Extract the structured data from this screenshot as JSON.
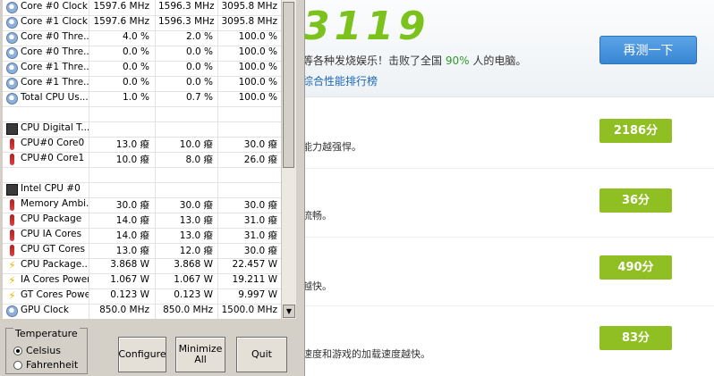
{
  "benchmark": {
    "score": "3119",
    "summary_left": "等各种发烧娱乐！击败了全国",
    "summary_percent": "90%",
    "summary_right": "人的电脑。",
    "rank_link": "综合性能排行榜",
    "retest_button": "再测一下",
    "rows": [
      {
        "desc": "能力越强悍。",
        "score": "2186分"
      },
      {
        "desc": "流畅。",
        "score": "36分"
      },
      {
        "desc": "越快。",
        "score": "490分"
      },
      {
        "desc": "速度和游戏的加载速度越快。",
        "score": "83分"
      }
    ]
  },
  "hwmonitor": {
    "rows": [
      {
        "icon": "clock-icon",
        "name": "Core #0 Clock",
        "v1": "1597.6 MHz",
        "v2": "1596.3 MHz",
        "v3": "3095.8 MHz"
      },
      {
        "icon": "clock-icon",
        "name": "Core #1 Clock",
        "v1": "1597.6 MHz",
        "v2": "1596.3 MHz",
        "v3": "3095.8 MHz"
      },
      {
        "icon": "clock-icon",
        "name": "Core #0 Thre...",
        "v1": "4.0 %",
        "v2": "2.0 %",
        "v3": "100.0 %"
      },
      {
        "icon": "clock-icon",
        "name": "Core #0 Thre...",
        "v1": "0.0 %",
        "v2": "0.0 %",
        "v3": "100.0 %"
      },
      {
        "icon": "clock-icon",
        "name": "Core #1 Thre...",
        "v1": "0.0 %",
        "v2": "0.0 %",
        "v3": "100.0 %"
      },
      {
        "icon": "clock-icon",
        "name": "Core #1 Thre...",
        "v1": "0.0 %",
        "v2": "0.0 %",
        "v3": "100.0 %"
      },
      {
        "icon": "clock-icon",
        "name": "Total CPU Us...",
        "v1": "1.0 %",
        "v2": "0.7 %",
        "v3": "100.0 %"
      },
      {
        "icon": "",
        "name": "",
        "v1": "",
        "v2": "",
        "v3": ""
      },
      {
        "icon": "chip-icon",
        "name": "CPU Digital T...",
        "v1": "",
        "v2": "",
        "v3": ""
      },
      {
        "icon": "thermometer-icon",
        "name": "CPU#0 Core0",
        "v1": "13.0 癈",
        "v2": "10.0 癈",
        "v3": "30.0 癈"
      },
      {
        "icon": "thermometer-icon",
        "name": "CPU#0 Core1",
        "v1": "10.0 癈",
        "v2": "8.0 癈",
        "v3": "26.0 癈"
      },
      {
        "icon": "",
        "name": "",
        "v1": "",
        "v2": "",
        "v3": ""
      },
      {
        "icon": "chip-icon",
        "name": "Intel CPU #0",
        "v1": "",
        "v2": "",
        "v3": ""
      },
      {
        "icon": "thermometer-icon",
        "name": "Memory Ambi...",
        "v1": "30.0 癈",
        "v2": "30.0 癈",
        "v3": "30.0 癈"
      },
      {
        "icon": "thermometer-icon",
        "name": "CPU Package",
        "v1": "14.0 癈",
        "v2": "13.0 癈",
        "v3": "31.0 癈"
      },
      {
        "icon": "thermometer-icon",
        "name": "CPU IA Cores",
        "v1": "14.0 癈",
        "v2": "13.0 癈",
        "v3": "31.0 癈"
      },
      {
        "icon": "thermometer-icon",
        "name": "CPU GT Cores",
        "v1": "13.0 癈",
        "v2": "12.0 癈",
        "v3": "30.0 癈"
      },
      {
        "icon": "lightning-icon",
        "name": "CPU Package...",
        "v1": "3.868 W",
        "v2": "3.868 W",
        "v3": "22.457 W"
      },
      {
        "icon": "lightning-icon",
        "name": "IA Cores Power",
        "v1": "1.067 W",
        "v2": "1.067 W",
        "v3": "19.211 W"
      },
      {
        "icon": "lightning-icon",
        "name": "GT Cores Power",
        "v1": "0.123 W",
        "v2": "0.123 W",
        "v3": "9.997 W"
      },
      {
        "icon": "clock-icon",
        "name": "GPU Clock",
        "v1": "850.0 MHz",
        "v2": "850.0 MHz",
        "v3": "1500.0 MHz"
      }
    ],
    "temperature": {
      "legend": "Temperature",
      "celsius": "Celsius",
      "fahrenheit": "Fahrenheit",
      "selected": "Celsius"
    },
    "buttons": {
      "configure": "Configure",
      "minimize": "Minimize All",
      "quit": "Quit"
    }
  }
}
